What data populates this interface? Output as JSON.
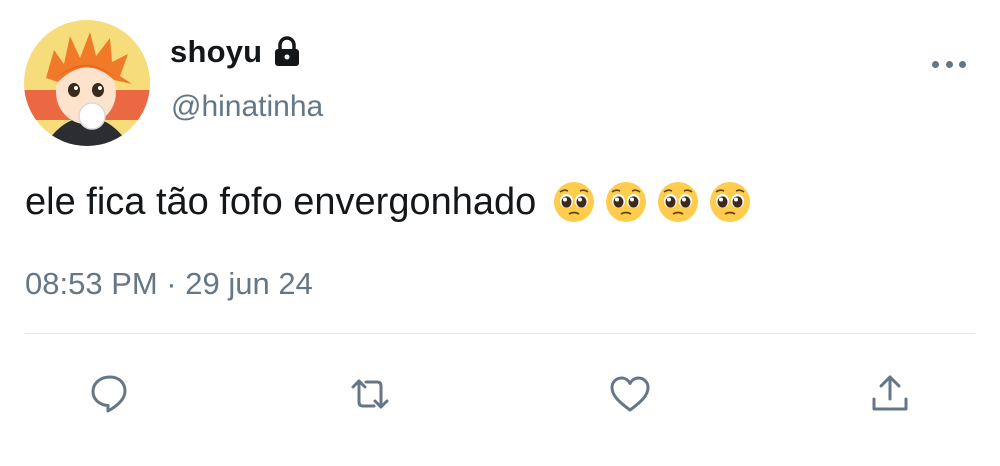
{
  "tweet": {
    "display_name": "shoyu",
    "handle": "@hinatinha",
    "text": "ele fica tão fofo envergonhado",
    "emojis": [
      "pleading-face-emoji",
      "pleading-face-emoji",
      "pleading-face-emoji",
      "pleading-face-emoji"
    ],
    "timestamp": "08:53 PM · 29 jun 24"
  },
  "icons": {
    "lock": "lock-icon",
    "more": "more-icon",
    "reply": "reply-icon",
    "retweet": "retweet-icon",
    "like": "heart-icon",
    "share": "share-icon"
  },
  "colors": {
    "text": "#14171a",
    "secondary": "#657786",
    "divider": "#e1e8ed"
  }
}
